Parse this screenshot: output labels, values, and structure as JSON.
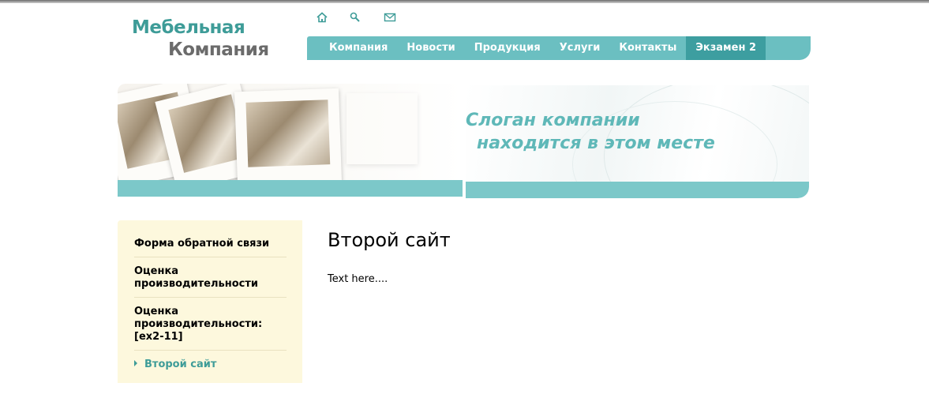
{
  "logo": {
    "line1": "Мебельная",
    "line2": "Компания"
  },
  "top_icons": [
    "home-icon",
    "search-icon",
    "mail-icon"
  ],
  "nav": {
    "items": [
      "Компания",
      "Новости",
      "Продукция",
      "Услуги",
      "Контакты",
      "Экзамен 2"
    ],
    "active_index": 5
  },
  "banner": {
    "slogan_line1": "Слоган компании",
    "slogan_line2": "находится в этом месте"
  },
  "sidebar": {
    "items": [
      "Форма обратной связи",
      "Оценка производительности",
      "Оценка производительности: [ex2-11]",
      "Второй сайт"
    ],
    "active_index": 3
  },
  "main": {
    "title": "Второй сайт",
    "text": "Text here...."
  },
  "colors": {
    "accent": "#6bbfc1",
    "accent_dark": "#3d9ea0",
    "logo_teal": "#3e9c98",
    "sidebar_bg": "#fdf8dd"
  }
}
